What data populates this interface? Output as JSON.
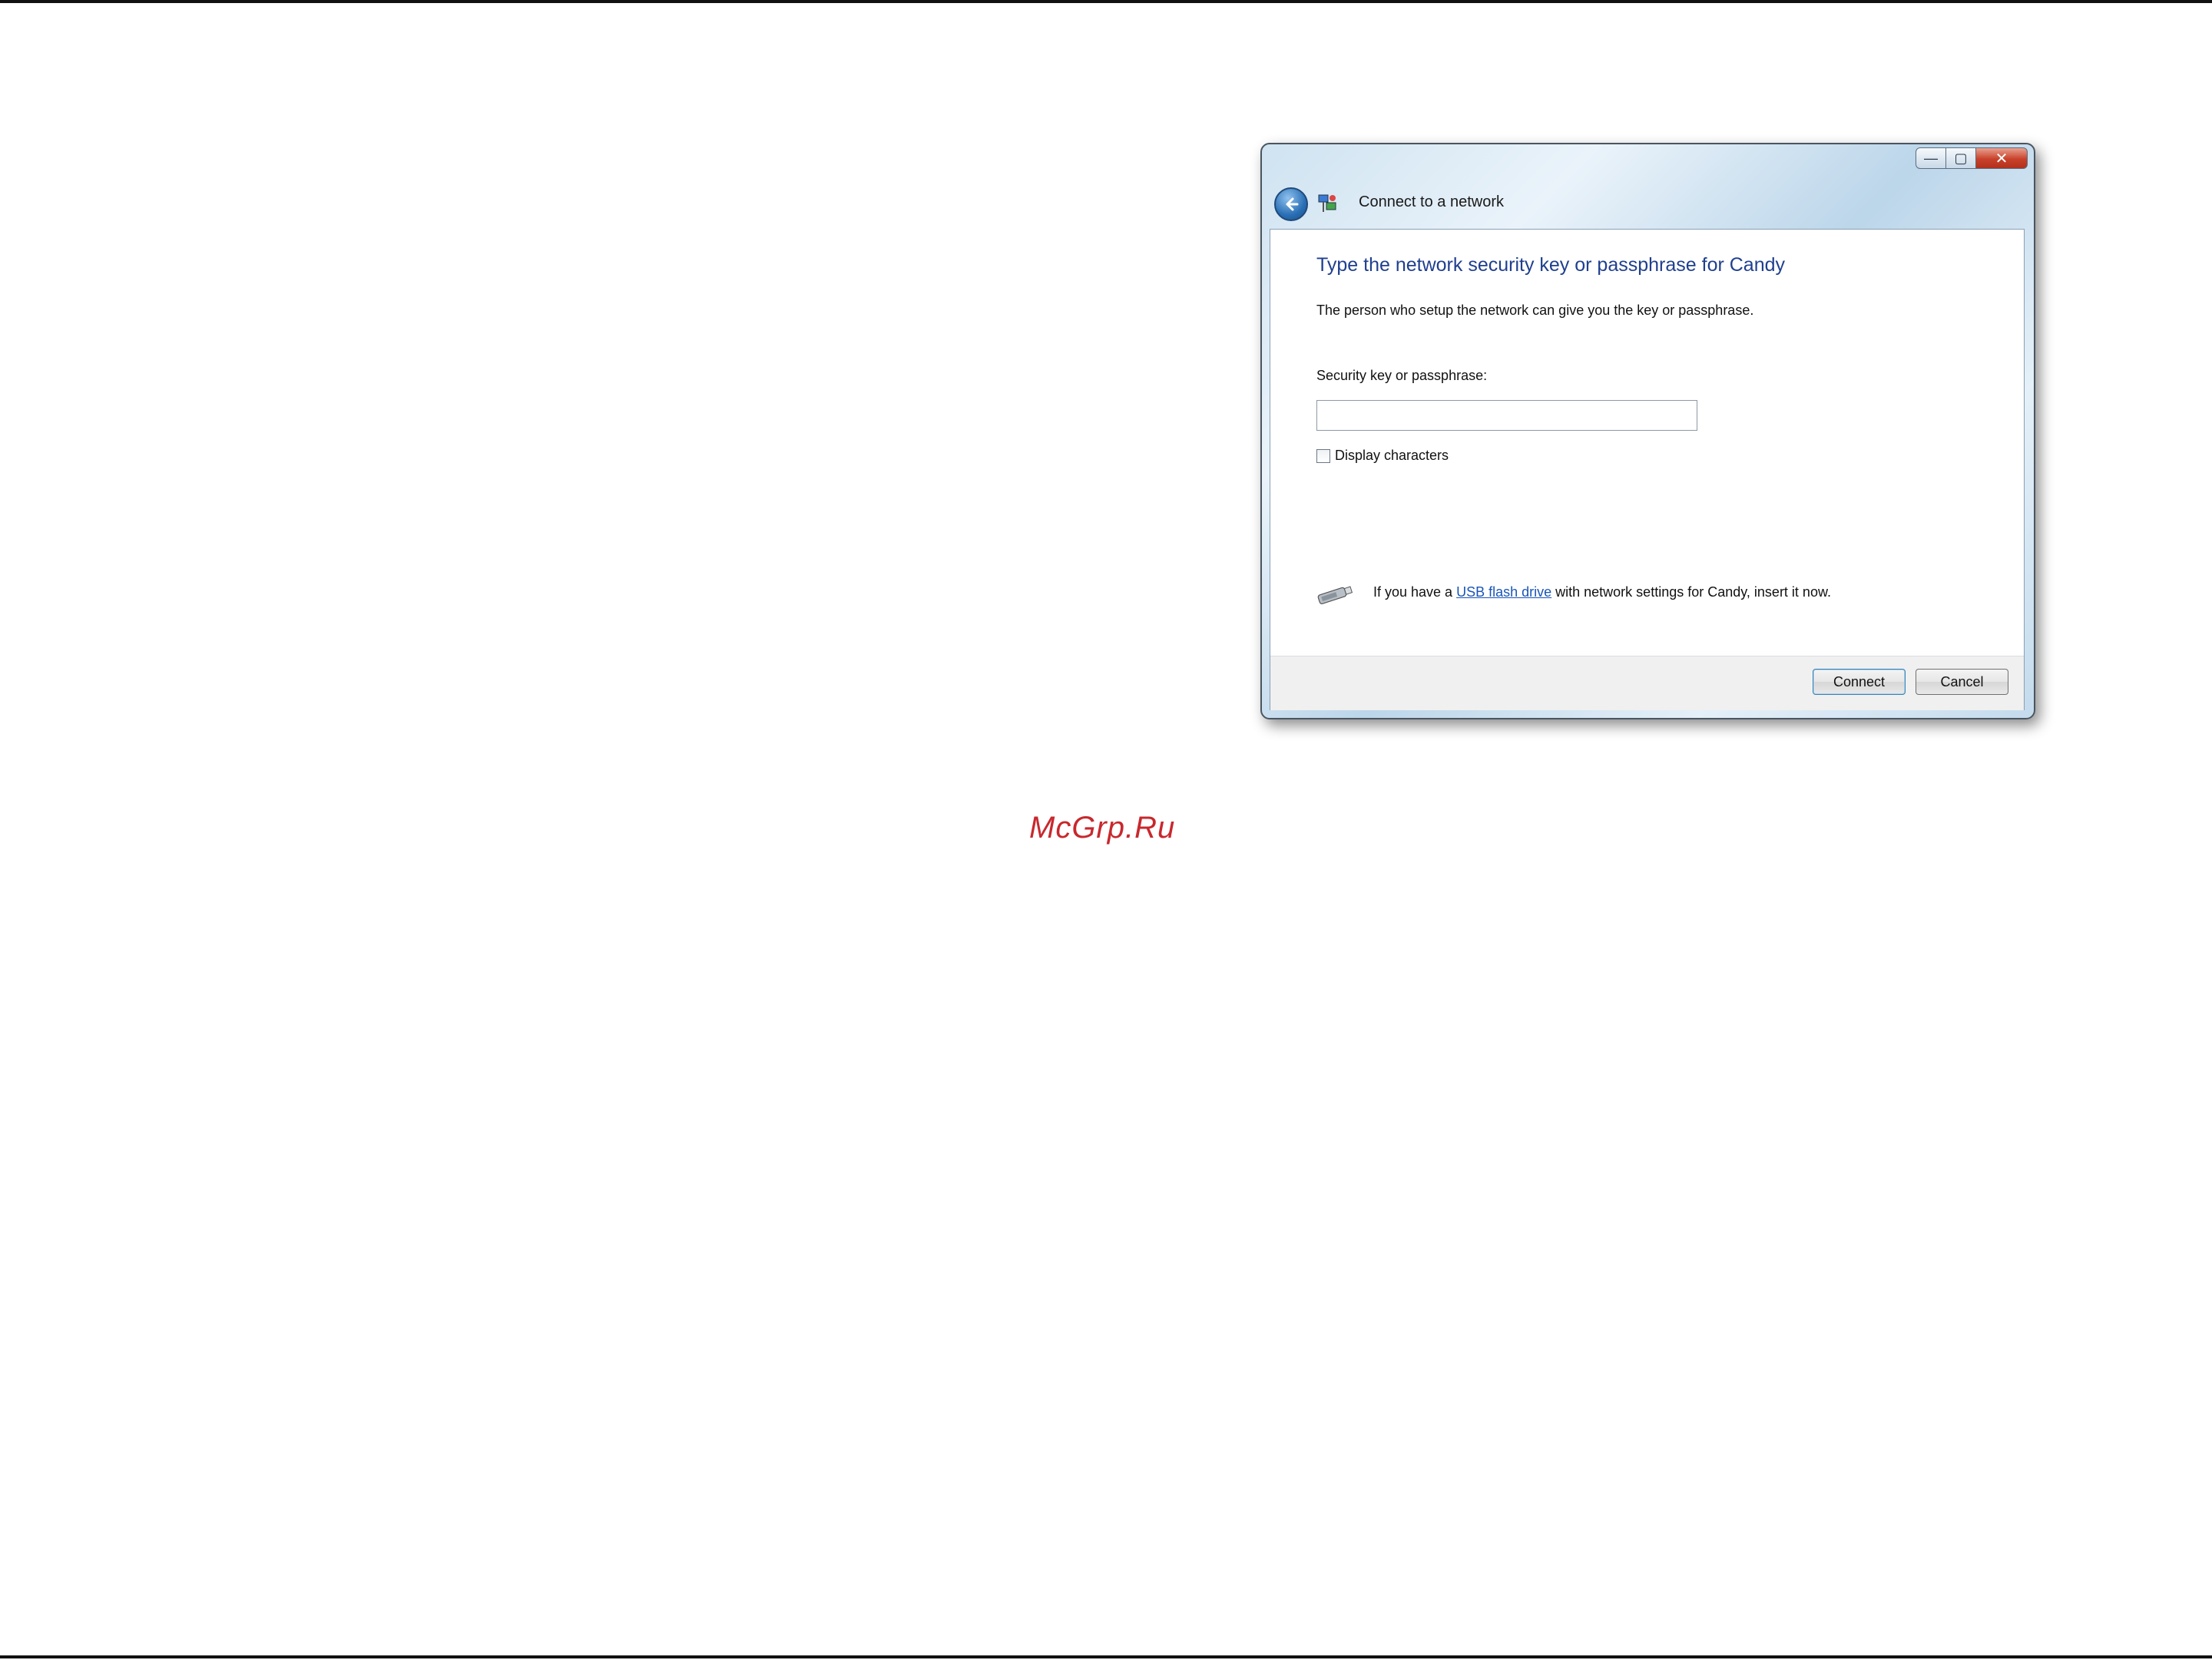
{
  "window": {
    "title": "Connect to a network",
    "controls": {
      "minimize": "—",
      "maximize": "▢",
      "close": "✕"
    }
  },
  "dialog": {
    "heading": "Type the network security key or passphrase for Candy",
    "description": "The person who setup the network can give you the key or passphrase.",
    "field_label": "Security key or passphrase:",
    "key_value": "",
    "checkbox_label": "Display characters",
    "checkbox_checked": false,
    "usb_prefix": "If you have a ",
    "usb_link": "USB flash drive",
    "usb_suffix": " with network settings for Candy, insert it now."
  },
  "buttons": {
    "connect": "Connect",
    "cancel": "Cancel"
  },
  "watermark": "McGrp.Ru",
  "icons": [
    "back-arrow-icon",
    "network-icon",
    "usb-drive-icon"
  ],
  "colors": {
    "heading": "#1f3f8f",
    "link": "#1a55b8",
    "watermark": "#c8282d"
  }
}
